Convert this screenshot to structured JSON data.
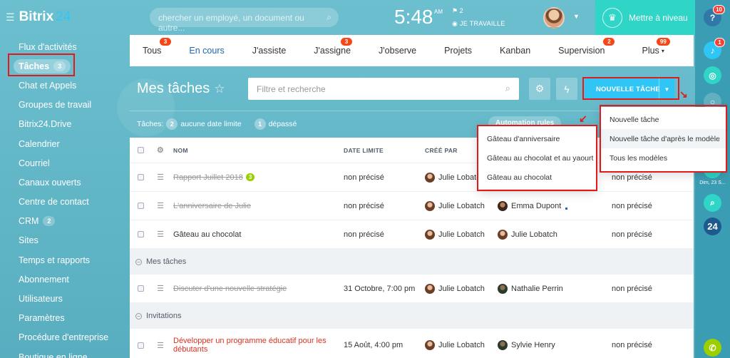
{
  "header": {
    "logo_main": "Bitrix",
    "logo_num": "24",
    "search_placeholder": "chercher un employé, un document ou autre...",
    "time": "5:48",
    "ampm": "AM",
    "flag_count": "2",
    "work_status": "JE TRAVAILLE",
    "upgrade_label": "Mettre à niveau"
  },
  "right_strip": {
    "help_badge": "10",
    "bell_badge": "1",
    "date_label": "Dim, 23 S...",
    "b24_label": "24"
  },
  "sidebar": {
    "items": [
      {
        "label": "Flux d'activités"
      },
      {
        "label": "Tâches",
        "count": "3"
      },
      {
        "label": "Chat et Appels"
      },
      {
        "label": "Groupes de travail"
      },
      {
        "label": "Bitrix24.Drive"
      },
      {
        "label": "Calendrier"
      },
      {
        "label": "Courriel"
      },
      {
        "label": "Canaux ouverts"
      },
      {
        "label": "Centre de contact"
      },
      {
        "label": "CRM",
        "count": "2"
      },
      {
        "label": "Sites"
      },
      {
        "label": "Temps et rapports"
      },
      {
        "label": "Abonnement"
      },
      {
        "label": "Utilisateurs"
      },
      {
        "label": "Paramètres"
      },
      {
        "label": "Procédure d'entreprise"
      },
      {
        "label": "Boutique en ligne"
      }
    ]
  },
  "tabs": [
    {
      "label": "Tous",
      "badge": "3"
    },
    {
      "label": "En cours"
    },
    {
      "label": "J'assiste"
    },
    {
      "label": "J'assigne",
      "badge": "3"
    },
    {
      "label": "J'observe"
    },
    {
      "label": "Projets"
    },
    {
      "label": "Kanban"
    },
    {
      "label": "Supervision",
      "badge": "2"
    },
    {
      "label": "Plus",
      "badge": "99"
    }
  ],
  "page": {
    "title": "Mes tâches",
    "filter_placeholder": "Filtre et recherche",
    "new_task_label": "NOUVELLE TÂCHE",
    "counters_label": "Tâches:",
    "no_deadline_count": "2",
    "no_deadline_label": "aucune date limite",
    "overdue_count": "1",
    "overdue_label": "dépassé",
    "automation_label": "Automation rules"
  },
  "grid": {
    "columns": {
      "name": "NOM",
      "deadline": "DATE LIMITE",
      "creator": "CRÉÉ PAR"
    },
    "rows_top": [
      {
        "name": "Rapport Juillet 2018",
        "badge": "3",
        "deadline": "non précisé",
        "creator": "Julie Lobatch",
        "resp": "",
        "more": "non précisé",
        "struck": true
      },
      {
        "name": "L'anniversaire de Julie",
        "deadline": "non précisé",
        "creator": "Julie Lobatch",
        "resp": "Emma Dupont",
        "more": "non précisé",
        "struck": true
      },
      {
        "name": "Gâteau au chocolat",
        "deadline": "non précisé",
        "creator": "Julie Lobatch",
        "resp": "Julie Lobatch",
        "more": "non précisé",
        "struck": false
      }
    ],
    "group_mine": "Mes tâches",
    "row_mine": {
      "name": "Discuter d'une nouvelle stratégie",
      "deadline": "31 Octobre, 7:00 pm",
      "creator": "Julie Lobatch",
      "resp": "Nathalie Perrin",
      "more": "non précisé"
    },
    "group_invites": "Invitations",
    "row_invite": {
      "name": "Développer un programme éducatif pour les débutants",
      "deadline": "15 Août, 4:00 pm",
      "creator": "Julie Lobatch",
      "resp": "Sylvie Henry",
      "more": "non précisé"
    }
  },
  "menu_new_task": [
    {
      "label": "Nouvelle tâche"
    },
    {
      "label": "Nouvelle tâche d'après le modèle"
    },
    {
      "label": "Tous les modèles"
    }
  ],
  "menu_templates": [
    {
      "label": "Gâteau d'anniversaire"
    },
    {
      "label": "Gâteau au chocolat et au yaourt"
    },
    {
      "label": "Gâteau au chocolat"
    }
  ],
  "colors": {
    "accent": "#2fc6f6",
    "highlight": "#e11b1b",
    "upgrade": "#2fd5c6"
  }
}
